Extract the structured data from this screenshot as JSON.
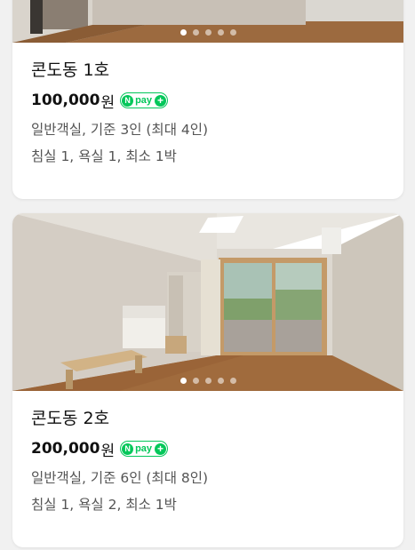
{
  "rooms": [
    {
      "title": "콘도동 1호",
      "price": "100,000",
      "price_unit": "원",
      "npay_text": "pay",
      "description": "일반객실, 기준 3인 (최대 4인)",
      "details": "침실 1, 욕실 1, 최소 1박",
      "photo_count": 5,
      "active_photo": 1
    },
    {
      "title": "콘도동 2호",
      "price": "200,000",
      "price_unit": "원",
      "npay_text": "pay",
      "description": "일반객실, 기준 6인 (최대 8인)",
      "details": "침실 1, 욕실 2, 최소 1박",
      "photo_count": 5,
      "active_photo": 1
    }
  ],
  "npay_badge": {
    "n": "N",
    "plus": "+"
  },
  "colors": {
    "npay_green": "#03c75a",
    "background": "#f1f1f1"
  }
}
